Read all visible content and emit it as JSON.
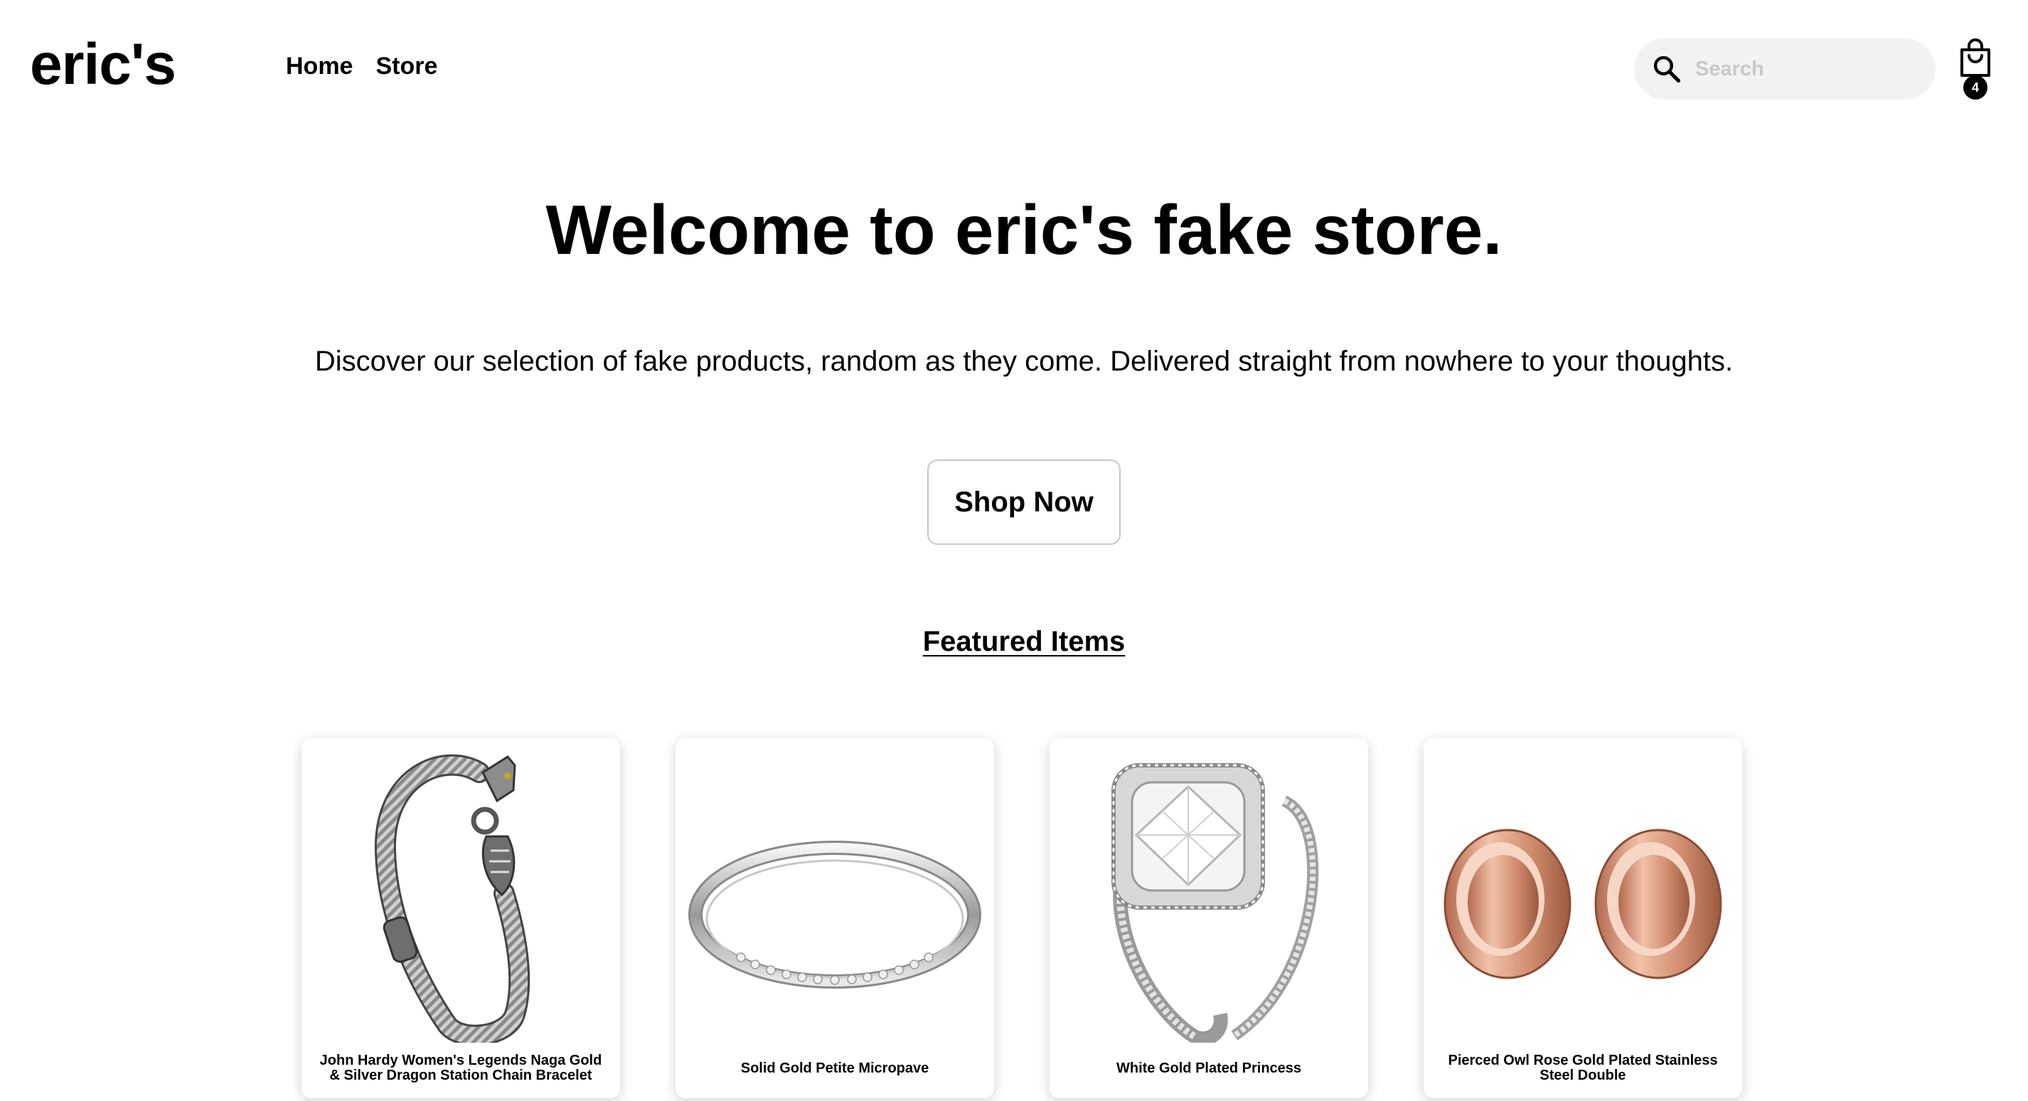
{
  "header": {
    "logo": "eric's",
    "nav": [
      {
        "label": "Home"
      },
      {
        "label": "Store"
      }
    ],
    "search": {
      "placeholder": "Search",
      "value": "",
      "icon": "search-icon"
    },
    "cart": {
      "icon": "shopping-bag-icon",
      "count": "4"
    }
  },
  "hero": {
    "title": "Welcome to eric's fake store.",
    "subtitle": "Discover our selection of fake products, random as they come. Delivered straight from nowhere to your thoughts.",
    "cta_label": "Shop Now"
  },
  "featured": {
    "heading": "Featured Items",
    "items": [
      {
        "name": "John Hardy Women's Legends Naga Gold & Silver Dragon Station Chain Bracelet",
        "image": "dragon-bracelet"
      },
      {
        "name": "Solid Gold Petite Micropave",
        "image": "silver-band-ring"
      },
      {
        "name": "White Gold Plated Princess",
        "image": "diamond-ring-set"
      },
      {
        "name": "Pierced Owl Rose Gold Plated Stainless Steel Double",
        "image": "rose-gold-plugs"
      }
    ]
  },
  "colors": {
    "background": "#ffffff",
    "text": "#000000",
    "search_bg": "#f2f2f2",
    "rose_gold": "#d99a7e"
  }
}
